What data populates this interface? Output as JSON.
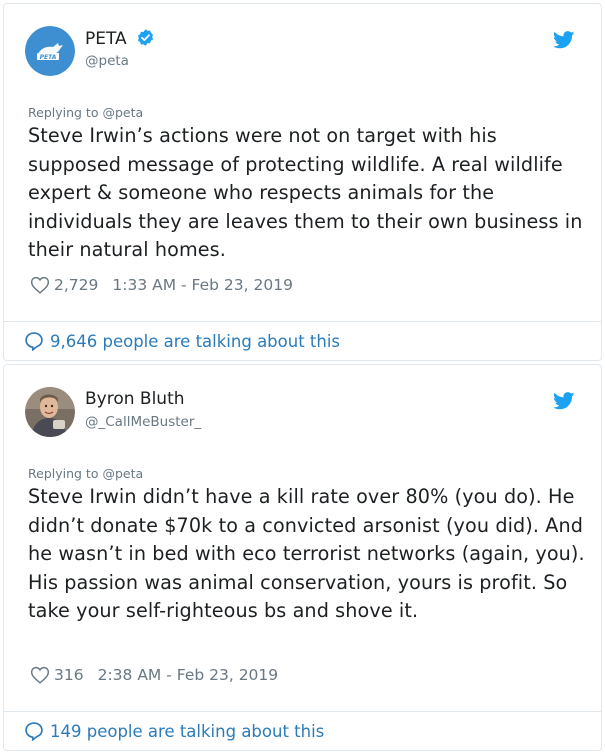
{
  "tweets": [
    {
      "display_name": "PETA",
      "verified": true,
      "handle": "@peta",
      "avatar_text": "PETA",
      "replying_to": "Replying to @peta",
      "text": "Steve Irwin’s actions were not on target with his supposed message of protecting wildlife. A real wildlife expert & someone who respects animals for the individuals they are leaves them to their own business in their natural homes.",
      "likes": "2,729",
      "timestamp": "1:33 AM - Feb 23, 2019",
      "talking": "9,646 people are talking about this"
    },
    {
      "display_name": "Byron Bluth",
      "verified": false,
      "handle": "@_CallMeBuster_",
      "replying_to": "Replying to @peta",
      "text": "Steve Irwin didn’t have a kill rate over 80% (you do). He didn’t donate $70k to a convicted arsonist (you did). And he wasn’t in bed with eco terrorist networks (again, you). His passion was animal conservation, yours is profit. So take your self-righteous bs and shove it.",
      "likes": "316",
      "timestamp": "2:38 AM - Feb 23, 2019",
      "talking": "149 people are talking about this"
    }
  ],
  "colors": {
    "twitter_blue": "#1da1f2",
    "link_blue": "#2b7bb9",
    "muted_gray": "#697882",
    "border": "#e1e8ed",
    "peta_avatar_bg": "#3d8fd1"
  },
  "icons": [
    "verified-badge-icon",
    "twitter-bird-icon",
    "heart-icon",
    "speech-bubble-icon"
  ]
}
